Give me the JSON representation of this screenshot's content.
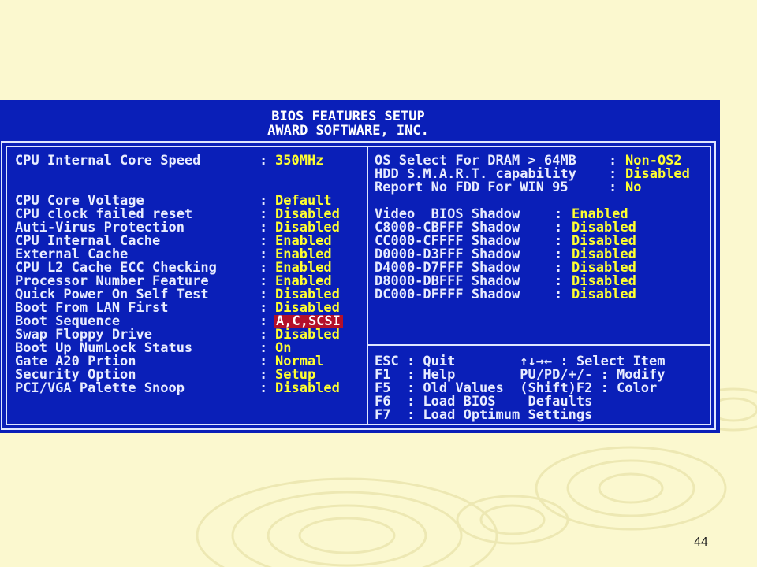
{
  "header": {
    "title_line1": "BIOS FEATURES SETUP",
    "title_line2": "AWARD SOFTWARE, INC."
  },
  "left_settings": [
    {
      "label": "CPU Internal Core Speed",
      "value": "350MHz"
    },
    {
      "label": "CPU Core Voltage",
      "value": "Default"
    },
    {
      "label": "CPU clock failed reset",
      "value": "Disabled"
    },
    {
      "label": "Auti-Virus Protection",
      "value": "Disabled"
    },
    {
      "label": "CPU Internal Cache",
      "value": "Enabled"
    },
    {
      "label": "External Cache",
      "value": "Enabled"
    },
    {
      "label": "CPU L2 Cache ECC Checking",
      "value": "Enabled"
    },
    {
      "label": "Processor Number Feature",
      "value": "Enabled"
    },
    {
      "label": "Quick Power On Self Test",
      "value": "Disabled"
    },
    {
      "label": "Boot From LAN First",
      "value": "Disabled"
    },
    {
      "label": "Boot Sequence",
      "value": "A,C,SCSI"
    },
    {
      "label": "Swap Floppy Drive",
      "value": "Disabled"
    },
    {
      "label": "Boot Up NumLock Status",
      "value": "On"
    },
    {
      "label": "Gate A20 Prtion",
      "value": "Normal"
    },
    {
      "label": "Security Option",
      "value": "Setup"
    },
    {
      "label": "PCI/VGA Palette Snoop",
      "value": "Disabled"
    }
  ],
  "right_top_settings": [
    {
      "label": "OS Select For DRAM > 64MB",
      "value": "Non-OS2"
    },
    {
      "label": "HDD S.M.A.R.T. capability",
      "value": "Disabled"
    },
    {
      "label": "Report No FDD For WIN 95",
      "value": "No"
    }
  ],
  "shadow_settings": [
    {
      "label": "Video  BIOS Shadow",
      "value": "Enabled"
    },
    {
      "label": "C8000-CBFFF Shadow",
      "value": "Disabled"
    },
    {
      "label": "CC000-CFFFF Shadow",
      "value": "Disabled"
    },
    {
      "label": "D0000-D3FFF Shadow",
      "value": "Disabled"
    },
    {
      "label": "D4000-D7FFF Shadow",
      "value": "Disabled"
    },
    {
      "label": "D8000-DBFFF Shadow",
      "value": "Disabled"
    },
    {
      "label": "DC000-DFFFF Shadow",
      "value": "Disabled"
    }
  ],
  "help_lines": [
    "ESC : Quit        ↑↓→← : Select Item",
    "F1  : Help        PU/PD/+/- : Modify",
    "F5  : Old Values  (Shift)F2 : Color",
    "F6  : Load BIOS    Defaults",
    "F7  : Load Optimum Settings"
  ],
  "selected_setting": "Boot Sequence",
  "colors": {
    "bios_background": "#0a1fb8",
    "value_text": "#ffff30",
    "selection_highlight": "#b4102a",
    "slide_background": "#fbf8cf"
  },
  "page_number": "44"
}
